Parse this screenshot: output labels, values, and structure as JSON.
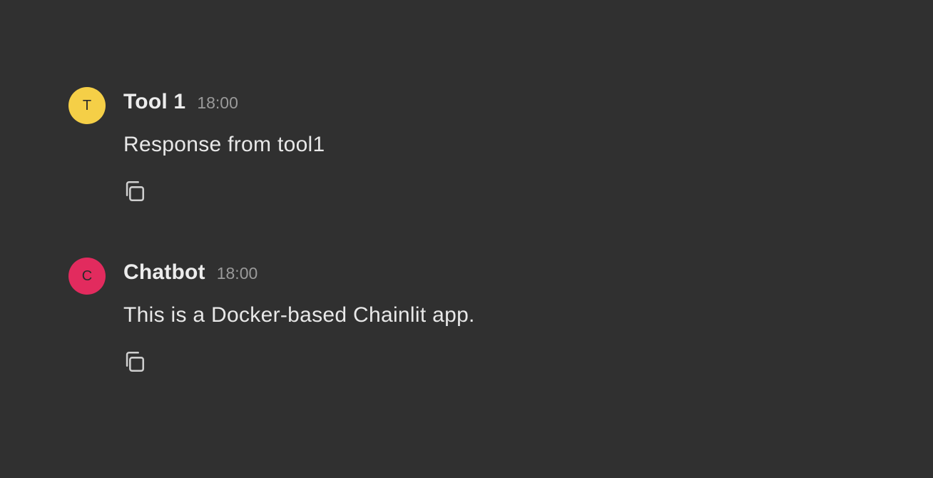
{
  "messages": [
    {
      "author": "Tool 1",
      "time": "18:00",
      "avatar_letter": "T",
      "avatar_color": "#f5cf47",
      "content": "Response from tool1",
      "copy_icon": "copy-icon"
    },
    {
      "author": "Chatbot",
      "time": "18:00",
      "avatar_letter": "C",
      "avatar_color": "#e22b5e",
      "content": "This is a Docker-based Chainlit app.",
      "copy_icon": "copy-icon"
    }
  ],
  "colors": {
    "background": "#303030",
    "text": "#e8e8e8",
    "timestamp": "#9a9a9a",
    "icon": "#cfcfcf"
  }
}
